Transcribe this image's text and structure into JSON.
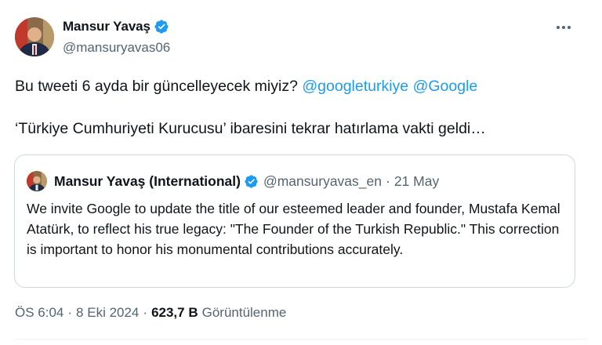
{
  "author": {
    "display_name": "Mansur Yavaş",
    "handle": "@mansuryavas06"
  },
  "tweet": {
    "text_before": "Bu tweeti 6 ayda bir güncelleyecek miyiz? ",
    "mentions": [
      "@googleturkiye",
      "@Google"
    ],
    "text_line2": "‘Türkiye Cumhuriyeti Kurucusu’ ibaresini tekrar hatırlama vakti geldi…"
  },
  "quote": {
    "display_name": "Mansur Yavaş (International)",
    "handle": "@mansuryavas_en",
    "separator": "·",
    "date": "21 May",
    "text": "We invite Google to update the title of our esteemed leader and founder, Mustafa Kemal Atatürk, to reflect his true legacy: \"The Founder of the Turkish Republic.\" This correction is important to honor his monumental contributions accurately."
  },
  "meta": {
    "time": "ÖS 6:04",
    "separator": "·",
    "date": "8 Eki 2024",
    "views_count": "623,7 B",
    "views_label": "Görüntülenme"
  },
  "icons": {
    "verified": "verified-badge-icon",
    "more": "more-options-icon"
  },
  "colors": {
    "accent": "#1d9bf0",
    "text": "#0f1419",
    "secondary": "#536471",
    "border": "#cfd9de"
  }
}
